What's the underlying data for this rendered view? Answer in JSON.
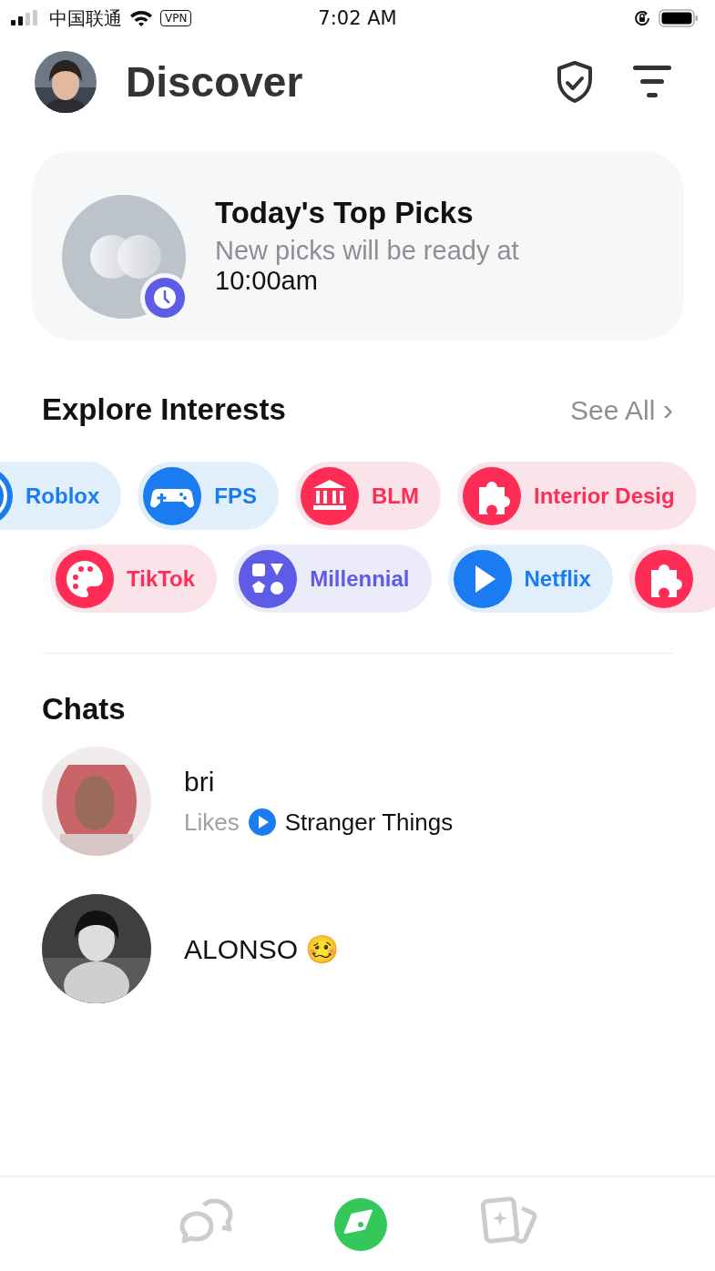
{
  "status_bar": {
    "carrier": "中国联通",
    "vpn": "VPN",
    "time": "7:02 AM"
  },
  "header": {
    "title": "Discover"
  },
  "top_picks": {
    "title": "Today's Top Picks",
    "subtitle": "New picks will be ready at",
    "time": "10:00am"
  },
  "interests": {
    "title": "Explore Interests",
    "see_all": "See All",
    "chevron": "›",
    "rows": [
      {
        "chips": [
          {
            "label": "Roblox",
            "kind": "circle",
            "color": "#1a7cf0"
          },
          {
            "label": "FPS",
            "kind": "gamepad",
            "color": "#1a7cf0"
          },
          {
            "label": "BLM",
            "kind": "bank",
            "color": "#ff2d55"
          },
          {
            "label": "Interior Desig",
            "kind": "puzzle",
            "color": "#ff2d55"
          }
        ]
      },
      {
        "chips": [
          {
            "label": "TikTok",
            "kind": "palette",
            "color": "#ff2d55"
          },
          {
            "label": "Millennial",
            "kind": "shapes",
            "color": "#5e5ce6"
          },
          {
            "label": "Netflix",
            "kind": "play",
            "color": "#1a7cf0"
          },
          {
            "kind": "puzzle",
            "color": "#ff2d55"
          }
        ]
      }
    ]
  },
  "chats": {
    "title": "Chats",
    "items": [
      {
        "name": "bri",
        "likes_label": "Likes",
        "likes": "Stranger Things"
      },
      {
        "name": "ALONSO 🥴"
      }
    ]
  },
  "tab_bar": [
    {
      "kind": "chats",
      "selected": false
    },
    {
      "kind": "discover",
      "selected": true
    },
    {
      "kind": "cards",
      "selected": false
    }
  ]
}
